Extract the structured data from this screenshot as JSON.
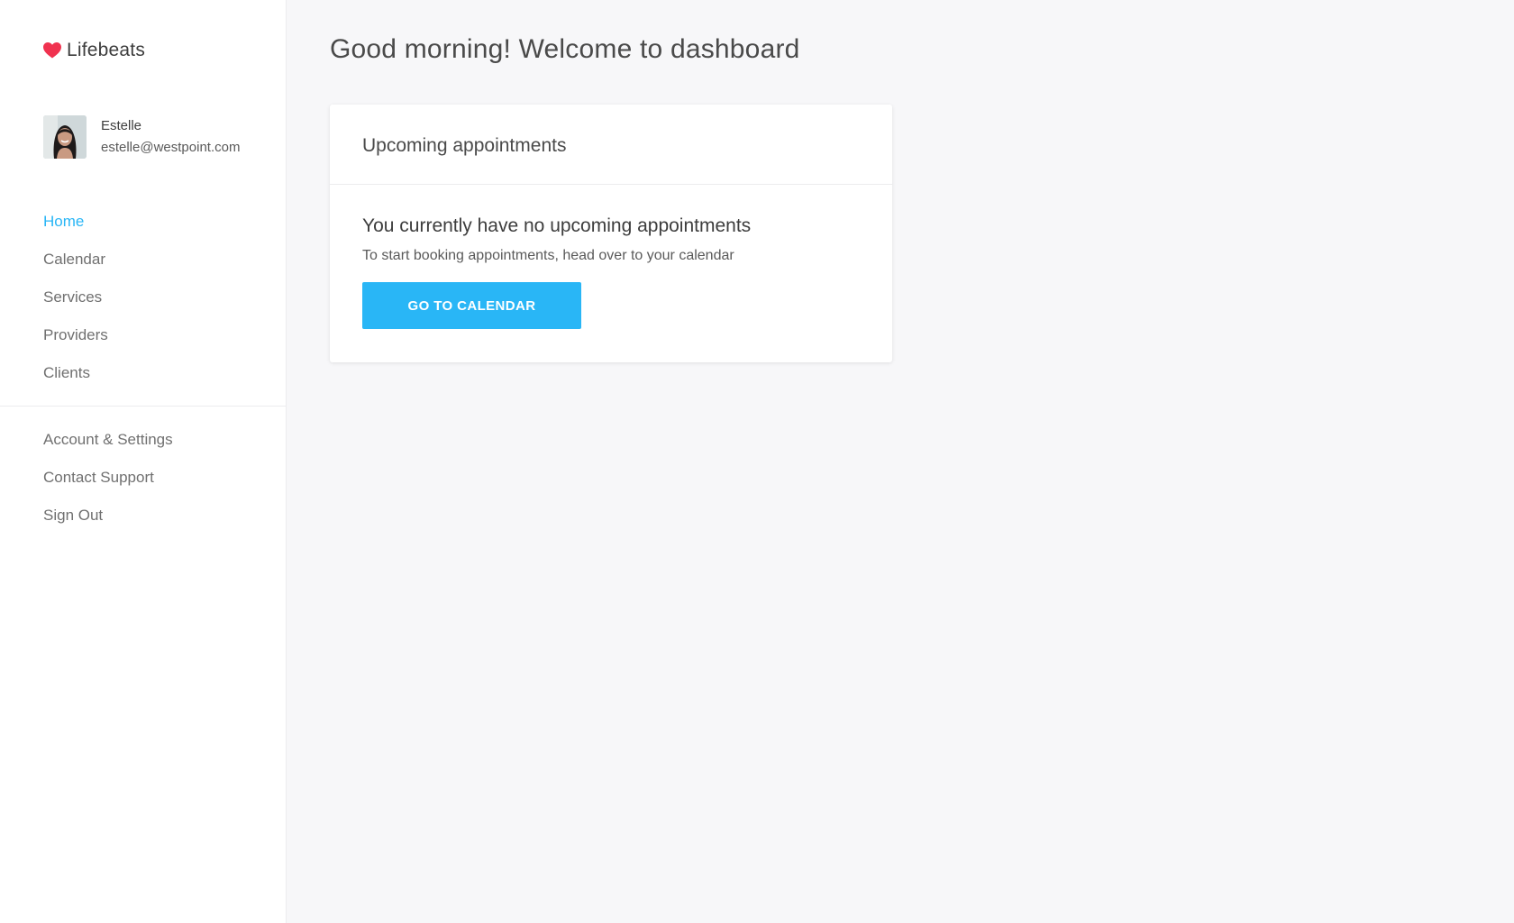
{
  "brand": {
    "name": "Lifebeats",
    "icon": "heart-icon",
    "icon_color": "#f0324f"
  },
  "user": {
    "name": "Estelle",
    "email": "estelle@westpoint.com"
  },
  "nav": {
    "primary": [
      {
        "label": "Home",
        "active": true
      },
      {
        "label": "Calendar"
      },
      {
        "label": "Services"
      },
      {
        "label": "Providers"
      },
      {
        "label": "Clients"
      }
    ],
    "secondary": [
      {
        "label": "Account & Settings"
      },
      {
        "label": "Contact Support"
      },
      {
        "label": "Sign Out"
      }
    ]
  },
  "main": {
    "title": "Good morning! Welcome to dashboard",
    "card": {
      "header": "Upcoming appointments",
      "empty_title": "You currently have no upcoming appointments",
      "empty_text": "To start booking appointments, head over to your calendar",
      "button_label": "GO TO CALENDAR"
    }
  },
  "colors": {
    "accent": "#29b6f6",
    "background": "#f7f7f9"
  }
}
